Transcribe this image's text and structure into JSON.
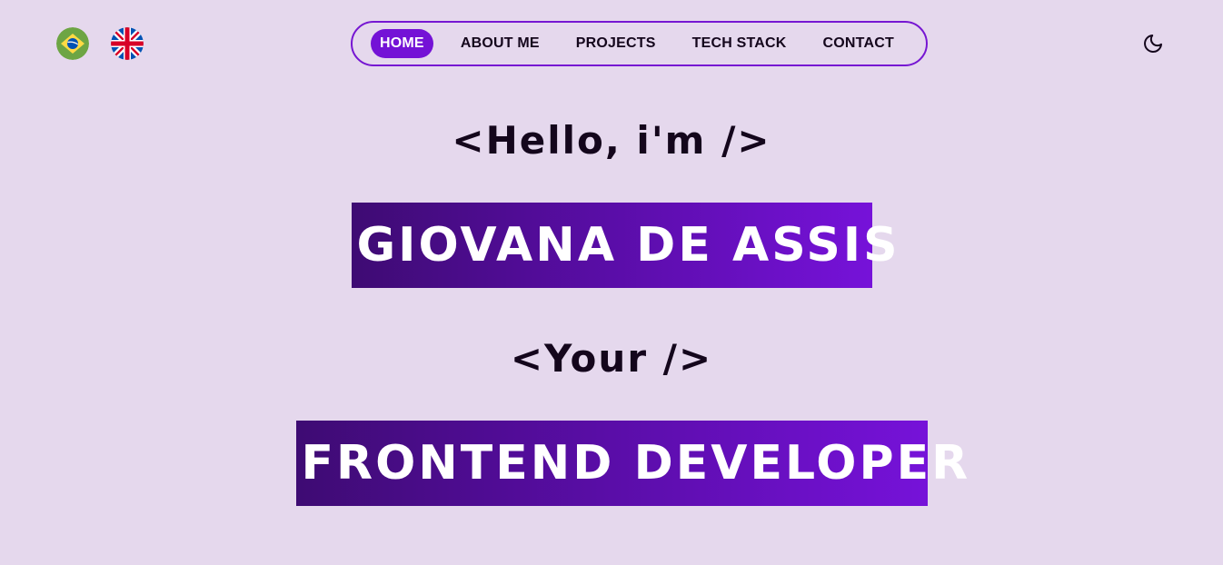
{
  "language_switch": {
    "flags": [
      {
        "icon": "brazil-flag-icon",
        "colors": [
          "#6da544",
          "#ffda44",
          "#0052b4"
        ]
      },
      {
        "icon": "uk-flag-icon",
        "colors": [
          "#0052b4",
          "#ffffff",
          "#d80027"
        ]
      }
    ]
  },
  "nav": {
    "items": [
      {
        "label": "HOME",
        "active": true
      },
      {
        "label": "ABOUT ME",
        "active": false
      },
      {
        "label": "PROJECTS",
        "active": false
      },
      {
        "label": "TECH STACK",
        "active": false
      },
      {
        "label": "CONTACT",
        "active": false
      }
    ],
    "accent_color": "#7412d6"
  },
  "theme_toggle": {
    "icon": "moon-icon"
  },
  "hero": {
    "greeting": "<Hello, i'm />",
    "name": "GIOVANA DE ASSIS",
    "role_prefix": "<Your />",
    "role": "FRONTEND DEVELOPER"
  },
  "colors": {
    "background": "#e5d8ed",
    "text": "#14061c",
    "banner_gradient_start": "#3e0b73",
    "banner_gradient_end": "#7612d9"
  }
}
